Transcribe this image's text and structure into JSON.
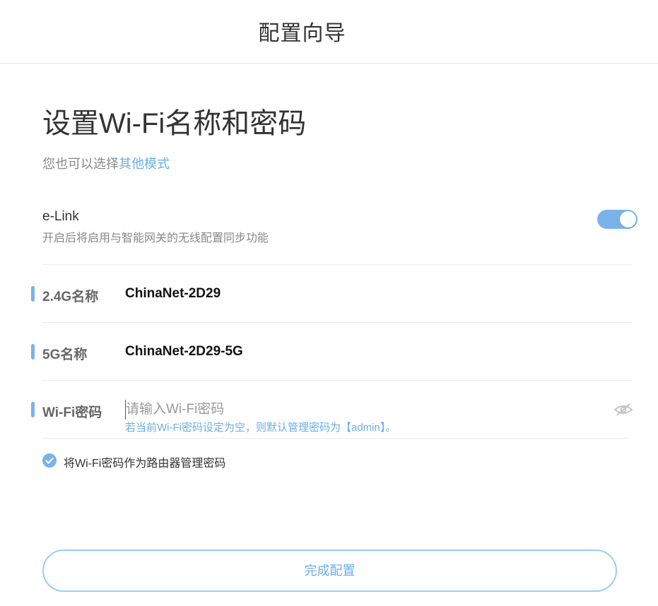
{
  "header": {
    "title": "配置向导"
  },
  "page": {
    "title": "设置Wi-Fi名称和密码",
    "subtitle_prefix": "您也可以选择",
    "subtitle_link": "其他模式"
  },
  "elink": {
    "title": "e-Link",
    "description": "开启后将启用与智能网关的无线配置同步功能",
    "enabled": true
  },
  "fields": {
    "ssid_24": {
      "label": "2.4G名称",
      "value": "ChinaNet-2D29"
    },
    "ssid_5": {
      "label": "5G名称",
      "value": "ChinaNet-2D29-5G"
    },
    "password": {
      "label": "Wi-Fi密码",
      "value": "",
      "placeholder": "请输入Wi-Fi密码",
      "hint": "若当前Wi-Fi密码设定为空，则默认管理密码为【admin】。",
      "icon": "eye-hidden-icon"
    }
  },
  "options": {
    "use_wifi_as_admin_label": "将Wi-Fi密码作为路由器管理密码",
    "use_wifi_as_admin_checked": true
  },
  "actions": {
    "finish_label": "完成配置"
  },
  "colors": {
    "accent": "#79b3ea",
    "link": "#6aaee6",
    "button_border": "#9acdf5"
  }
}
